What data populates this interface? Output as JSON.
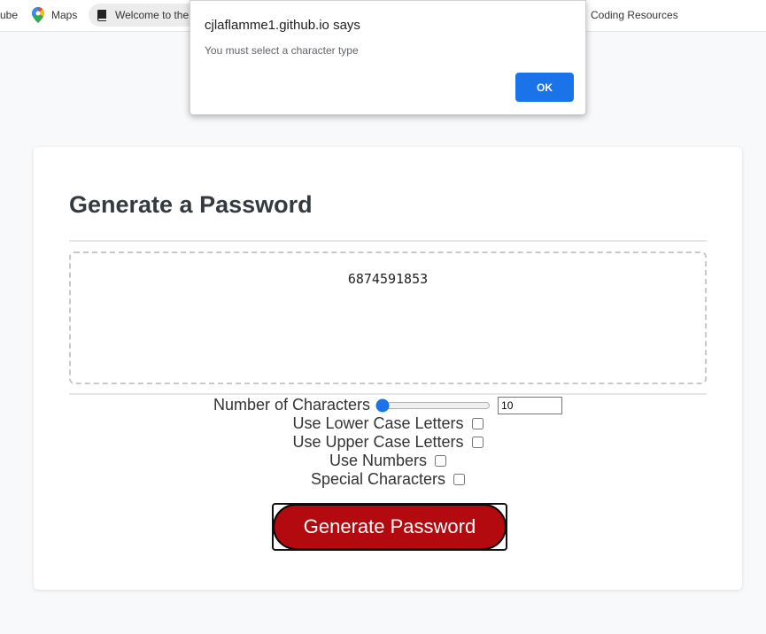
{
  "bookmarks": {
    "youtube_label": "ube",
    "maps_label": "Maps",
    "welcome_label": "Welcome to the",
    "coding_label": "Coding Resources"
  },
  "card": {
    "title": "Generate a Password",
    "password": "6874591853"
  },
  "options": {
    "length_label": "Number of Characters",
    "length_value": "10",
    "lowercase_label": "Use Lower Case Letters",
    "uppercase_label": "Use Upper Case Letters",
    "numbers_label": "Use Numbers",
    "special_label": "Special Characters",
    "lowercase_checked": false,
    "uppercase_checked": false,
    "numbers_checked": false,
    "special_checked": false
  },
  "generate_button_label": "Generate Password",
  "alert": {
    "title": "cjlaflamme1.github.io says",
    "message": "You must select a character type",
    "ok_label": "OK"
  },
  "colors": {
    "accent": "#1a73e8",
    "button_red": "#b20a0f"
  }
}
